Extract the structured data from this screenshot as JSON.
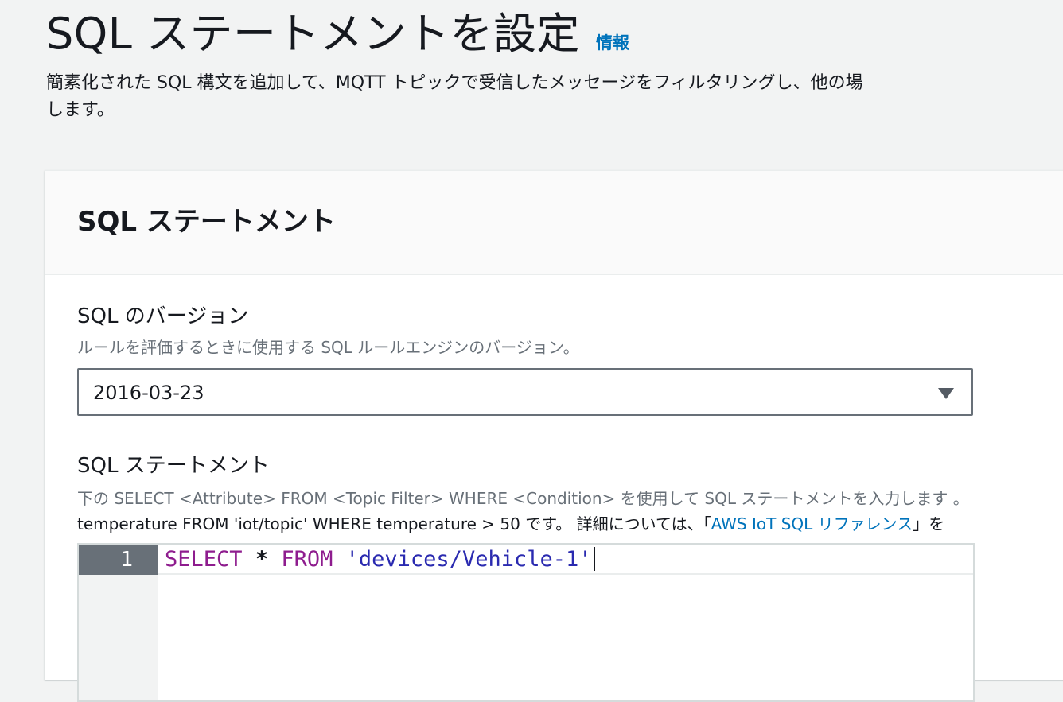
{
  "header": {
    "title": "SQL ステートメントを設定",
    "info_link": "情報",
    "description_line1": "簡素化された SQL 構文を追加して、MQTT トピックで受信したメッセージをフィルタリングし、他の場",
    "description_line2": "します。"
  },
  "panel": {
    "title": "SQL ステートメント",
    "sql_version": {
      "label": "SQL のバージョン",
      "description": "ルールを評価するときに使用する SQL ルールエンジンのバージョン。",
      "selected": "2016-03-23"
    },
    "sql_statement": {
      "label": "SQL ステートメント",
      "description_line1": "下の SELECT <Attribute> FROM <Topic Filter> WHERE <Condition> を使用して SQL ステートメントを入力します 。",
      "description_line2_prefix": "temperature FROM 'iot/topic' WHERE temperature > 50 です。 詳細については、「",
      "reference_link": "AWS IoT SQL リファレンス",
      "description_line2_suffix": "」を",
      "editor": {
        "line_number": "1",
        "tokens": {
          "select": "SELECT",
          "star": "*",
          "from": "FROM",
          "topic": "'devices/Vehicle-1'"
        }
      }
    }
  }
}
